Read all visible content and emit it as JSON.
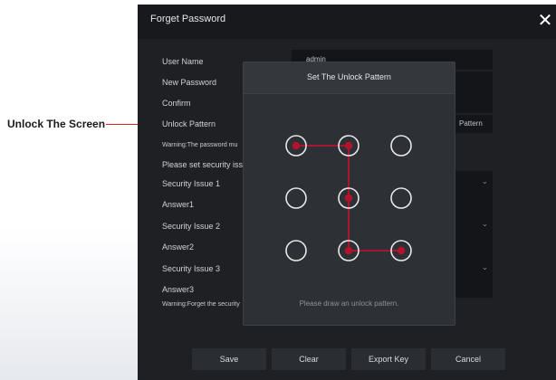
{
  "callout": {
    "label": "Unlock The Screen"
  },
  "dialog": {
    "title": "Forget Password",
    "close_icon": "close-icon",
    "fields": {
      "user_name_label": "User Name",
      "user_name_value": "admin",
      "new_password_label": "New Password",
      "confirm_label": "Confirm",
      "unlock_pattern_label": "Unlock Pattern",
      "unlock_pattern_button_fragment": "Pattern",
      "warning_password": "Warning:The password mu",
      "security_prompt": "Please set security issu",
      "security_issue_1_label": "Security Issue 1",
      "answer1_label": "Answer1",
      "security_issue_2_label": "Security Issue 2",
      "answer2_label": "Answer2",
      "security_issue_3_label": "Security Issue 3",
      "answer3_label": "Answer3",
      "warning_security": "Warning:Forget the security"
    },
    "buttons": {
      "save": "Save",
      "clear": "Clear",
      "export_key": "Export Key",
      "cancel": "Cancel"
    }
  },
  "pattern_dialog": {
    "title": "Set The Unlock Pattern",
    "hint": "Please draw an unlock pattern.",
    "grid_size": 3,
    "selected_sequence": [
      0,
      1,
      4,
      7,
      8
    ],
    "colors": {
      "line": "#c8102e",
      "dot_fill": "#b5122b",
      "ring": "#e8e8e8"
    }
  }
}
